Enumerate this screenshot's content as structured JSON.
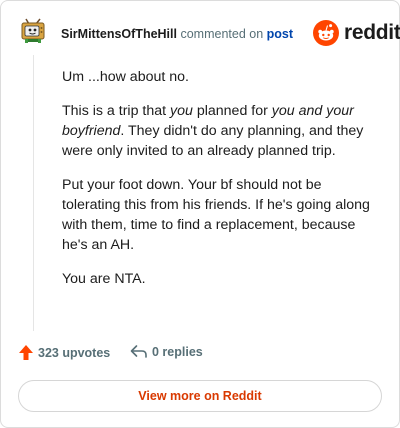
{
  "header": {
    "username": "SirMittensOfTheHill",
    "action_text": "commented on",
    "post_link": "post",
    "brand": "reddit"
  },
  "comment": {
    "p1": "Um ...how about no.",
    "p2": {
      "a": "This is a trip that ",
      "b": "you",
      "c": " planned for ",
      "d": "you and your boyfriend",
      "e": ". They didn't do any planning, and they were only invited to an already planned trip."
    },
    "p3": "Put your foot down. Your bf should not be tolerating this from his friends. If he's going along with them, time to find a replacement, because he's an AH.",
    "p4": "You are NTA."
  },
  "actions": {
    "upvotes": "323 upvotes",
    "replies": "0 replies"
  },
  "footer": {
    "view_more": "View more on Reddit"
  },
  "colors": {
    "brand_orange": "#ff4500",
    "link_blue": "#0045ac",
    "muted": "#576f76"
  },
  "icons": [
    "avatar-tv-icon",
    "reddit-alien-icon",
    "upvote-arrow-icon",
    "reply-icon"
  ]
}
